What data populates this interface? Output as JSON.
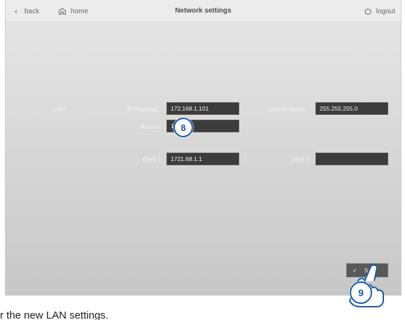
{
  "header": {
    "back_label": "back",
    "home_label": "home",
    "title": "Network settings",
    "logout_label": "logout"
  },
  "form": {
    "lan_label": "LAN:",
    "ip_label": "IP Address:",
    "ip_value": "172.168.1.101",
    "subnet_label": "Subnet Mask:",
    "subnet_value": "255.255.255.0",
    "router_label": "Router:",
    "router_value": "17",
    "dns1_label": "DNS 1:",
    "dns1_value": "1721.68.1.1",
    "dns2_label": "DNS 2:",
    "dns2_value": ""
  },
  "actions": {
    "save_label": "Save"
  },
  "annotations": {
    "step_8": "8",
    "step_9": "9"
  },
  "bottom": {
    "caption": "r the new LAN settings."
  },
  "colors": {
    "field_bg": "#3c3c3c",
    "accent": "#1d5aa5"
  },
  "icons": {
    "back": "chevron-left-icon",
    "home": "home-icon",
    "logout": "power-icon",
    "save": "check-icon",
    "pointer": "hand-pointer-icon"
  }
}
